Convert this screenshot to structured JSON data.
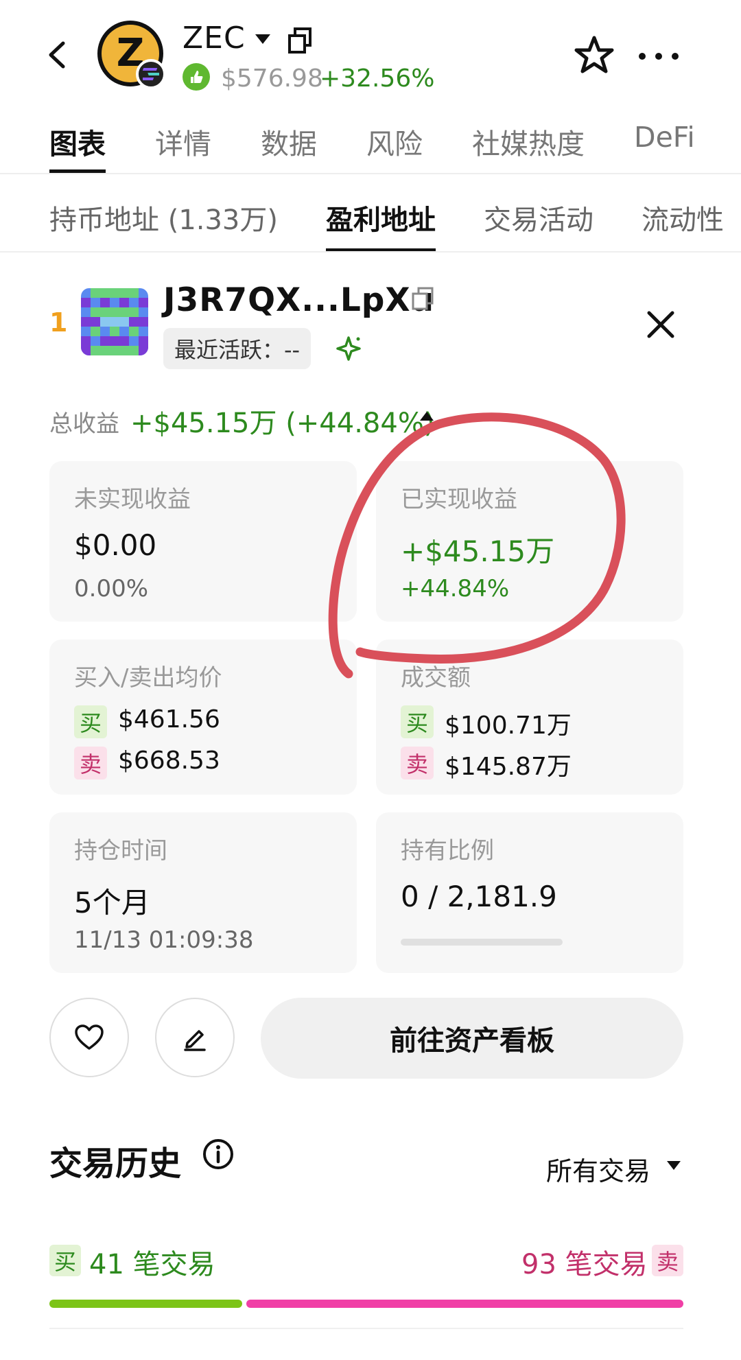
{
  "header": {
    "coin_symbol": "ZEC",
    "coin_logo_letter": "Z",
    "price": "$576.98",
    "change": "+32.56%",
    "icons": [
      "back-icon",
      "coin-logo",
      "solana-chain-icon",
      "caret-down-icon",
      "copy-icon",
      "verified-icon",
      "star-icon",
      "more-icon"
    ]
  },
  "top_tabs": [
    {
      "label": "图表",
      "active": true
    },
    {
      "label": "详情",
      "active": false
    },
    {
      "label": "数据",
      "active": false
    },
    {
      "label": "风险",
      "active": false
    },
    {
      "label": "社媒热度",
      "active": false
    },
    {
      "label": "DeFi",
      "active": false
    }
  ],
  "sub_tabs": [
    {
      "label": "持币地址 (1.33万)",
      "active": false
    },
    {
      "label": "盈利地址",
      "active": true
    },
    {
      "label": "交易活动",
      "active": false
    },
    {
      "label": "流动性",
      "active": false
    }
  ],
  "address_card": {
    "rank": "1",
    "address": "J3R7QX...LpXu",
    "activity": "最近活跃：--",
    "total_label": "总收益",
    "total_value": "+$45.15万 (+44.84%)"
  },
  "stats": {
    "unrealized": {
      "label": "未实现收益",
      "value": "$0.00",
      "percent": "0.00%"
    },
    "realized": {
      "label": "已实现收益",
      "value": "+$45.15万",
      "percent": "+44.84%"
    },
    "avg_price": {
      "label": "买入/卖出均价",
      "buy_tag": "买",
      "buy": "$461.56",
      "sell_tag": "卖",
      "sell": "$668.53"
    },
    "volume": {
      "label": "成交额",
      "buy_tag": "买",
      "buy": "$100.71万",
      "sell_tag": "卖",
      "sell": "$145.87万"
    },
    "holding_time": {
      "label": "持仓时间",
      "value": "5个月",
      "timestamp": "11/13 01:09:38"
    },
    "holding_ratio": {
      "label": "持有比例",
      "value": "0 / 2,181.9",
      "fraction": 0
    }
  },
  "actions": {
    "dashboard_label": "前往资产看板"
  },
  "history": {
    "title": "交易历史",
    "filter": "所有交易",
    "buy_tag": "买",
    "buy_count": "41 笔交易",
    "sell_count": "93 笔交易",
    "sell_tag": "卖",
    "buy_n": 41,
    "sell_n": 93
  },
  "colors": {
    "profit_green": "#2d8a1e",
    "sell_pink": "#c2306a",
    "buy_bar": "#7cc417",
    "sell_bar": "#f03fa6",
    "annotation_red": "#d9505a"
  }
}
